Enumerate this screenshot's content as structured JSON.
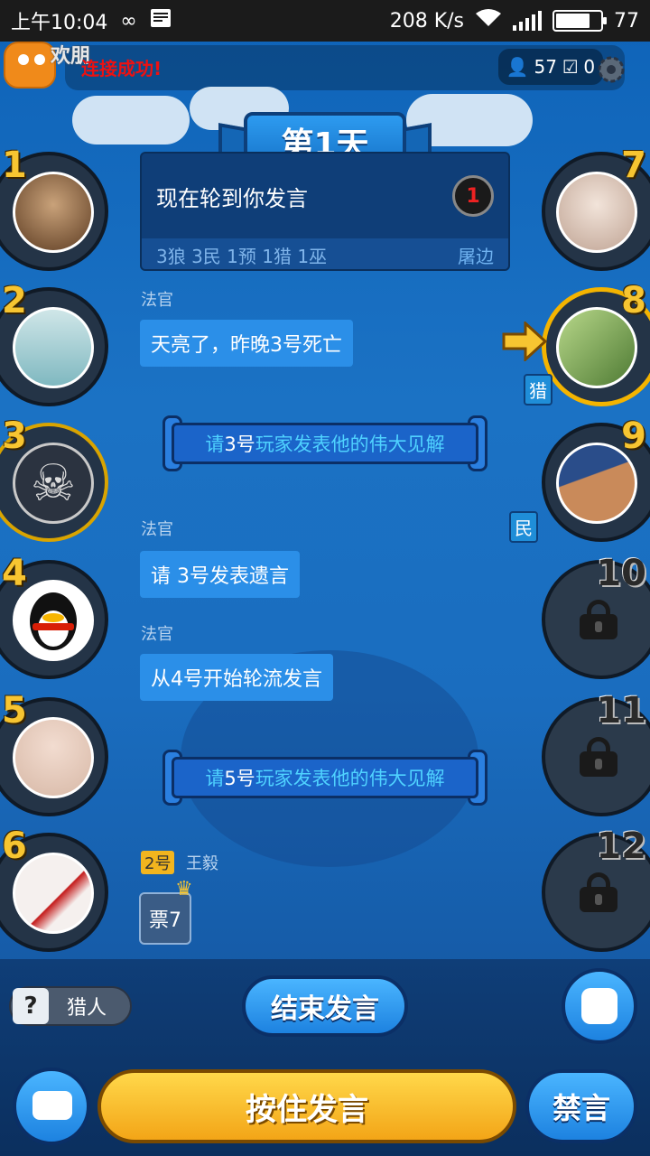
{
  "status_bar": {
    "time": "上午10:04",
    "net_speed": "208 K/s",
    "battery": "77",
    "battery_level": 0.77
  },
  "header": {
    "app_name": "欢朋",
    "connection_status": "连接成功!",
    "online_count": "57",
    "ready_count": "0"
  },
  "game": {
    "day_title": "第1天",
    "turn_message": "现在轮到你发言",
    "timer": "1",
    "roles_summary": "3狼 3民 1预 1猎 1巫",
    "win_rule": "屠边"
  },
  "seats": {
    "left": [
      {
        "num": "1",
        "state": "player"
      },
      {
        "num": "2",
        "state": "player"
      },
      {
        "num": "3",
        "state": "dead"
      },
      {
        "num": "4",
        "state": "player"
      },
      {
        "num": "5",
        "state": "player"
      },
      {
        "num": "6",
        "state": "player"
      }
    ],
    "right": [
      {
        "num": "7",
        "state": "player"
      },
      {
        "num": "8",
        "state": "active",
        "tag": "猎"
      },
      {
        "num": "9",
        "state": "player",
        "tag": "民"
      },
      {
        "num": "10",
        "state": "locked"
      },
      {
        "num": "11",
        "state": "locked"
      },
      {
        "num": "12",
        "state": "locked"
      }
    ]
  },
  "chat": {
    "judge_label": "法官",
    "msg1": "天亮了，昨晚3号死亡",
    "scroll1_pre": "请",
    "scroll1_num": "3号",
    "scroll1_mid": "玩家",
    "scroll1_hl": "发表他的伟大见解",
    "msg2": "请 3号发表遗言",
    "msg3": "从4号开始轮流发言",
    "scroll2_pre": "请",
    "scroll2_num": "5号",
    "scroll2_mid": "玩家",
    "scroll2_hl": "发表他的伟大见解",
    "vote_seat": "2号",
    "vote_player": "王毅",
    "vote_card": "票7"
  },
  "controls": {
    "help_icon": "?",
    "my_role": "猎人",
    "end_speech": "结束发言",
    "hold_to_speak": "按住发言",
    "mute": "禁言"
  },
  "colors": {
    "accent_blue": "#1d82e0",
    "gold": "#f7c531",
    "hold_button": "#f3a517"
  }
}
